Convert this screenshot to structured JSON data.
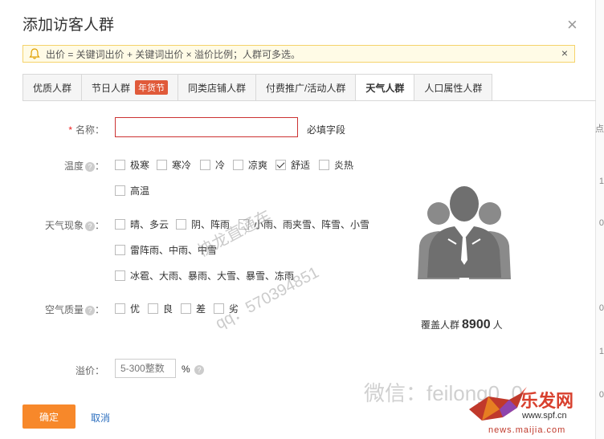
{
  "dialog": {
    "title": "添加访客人群",
    "close": "×"
  },
  "notice": {
    "text": "出价 = 关键词出价 + 关键词出价 × 溢价比例；人群可多选。",
    "close": "×"
  },
  "tabs": [
    {
      "label": "优质人群"
    },
    {
      "label": "节日人群",
      "badge": "年货节"
    },
    {
      "label": "同类店铺人群"
    },
    {
      "label": "付费推广/活动人群"
    },
    {
      "label": "天气人群"
    },
    {
      "label": "人口属性人群"
    }
  ],
  "form": {
    "name_label": "名称：",
    "name_required_mark": "*",
    "name_value": "",
    "name_hint": "必填字段",
    "temperature_label": "温度",
    "temperature_options": [
      "极寒",
      "寒冷",
      "冷",
      "凉爽",
      "舒适",
      "炎热",
      "高温"
    ],
    "temperature_checked": "舒适",
    "weather_label": "天气现象",
    "weather_options": [
      "晴、多云",
      "阴、阵雨",
      "小雨、雨夹雪、阵雪、小雪",
      "雷阵雨、中雨、中雪",
      "冰雹、大雨、暴雨、大雪、暴雪、冻雨"
    ],
    "air_label": "空气质量",
    "air_options": [
      "优",
      "良",
      "差",
      "劣"
    ],
    "colon": "：",
    "premium_label": "溢价：",
    "premium_placeholder": "5-300整数",
    "premium_unit": "%",
    "help": "?"
  },
  "coverage": {
    "prefix": "覆盖人群",
    "value": "8900",
    "suffix": "人"
  },
  "buttons": {
    "confirm": "确定",
    "cancel": "取消"
  },
  "edge_digits": [
    "点",
    "1",
    "0",
    "0",
    "1",
    "0"
  ],
  "watermarks": {
    "line1": "快龙直通车",
    "line2": "qq：570394851",
    "line3": "微信：feilong0_0",
    "brand": "乐发网",
    "site1": "www.spf.cn",
    "site2": "news.maijia.com"
  },
  "colors": {
    "accent": "#f7882a",
    "badge": "#e05a3a",
    "link": "#2c6fbf",
    "required": "#e22222"
  }
}
